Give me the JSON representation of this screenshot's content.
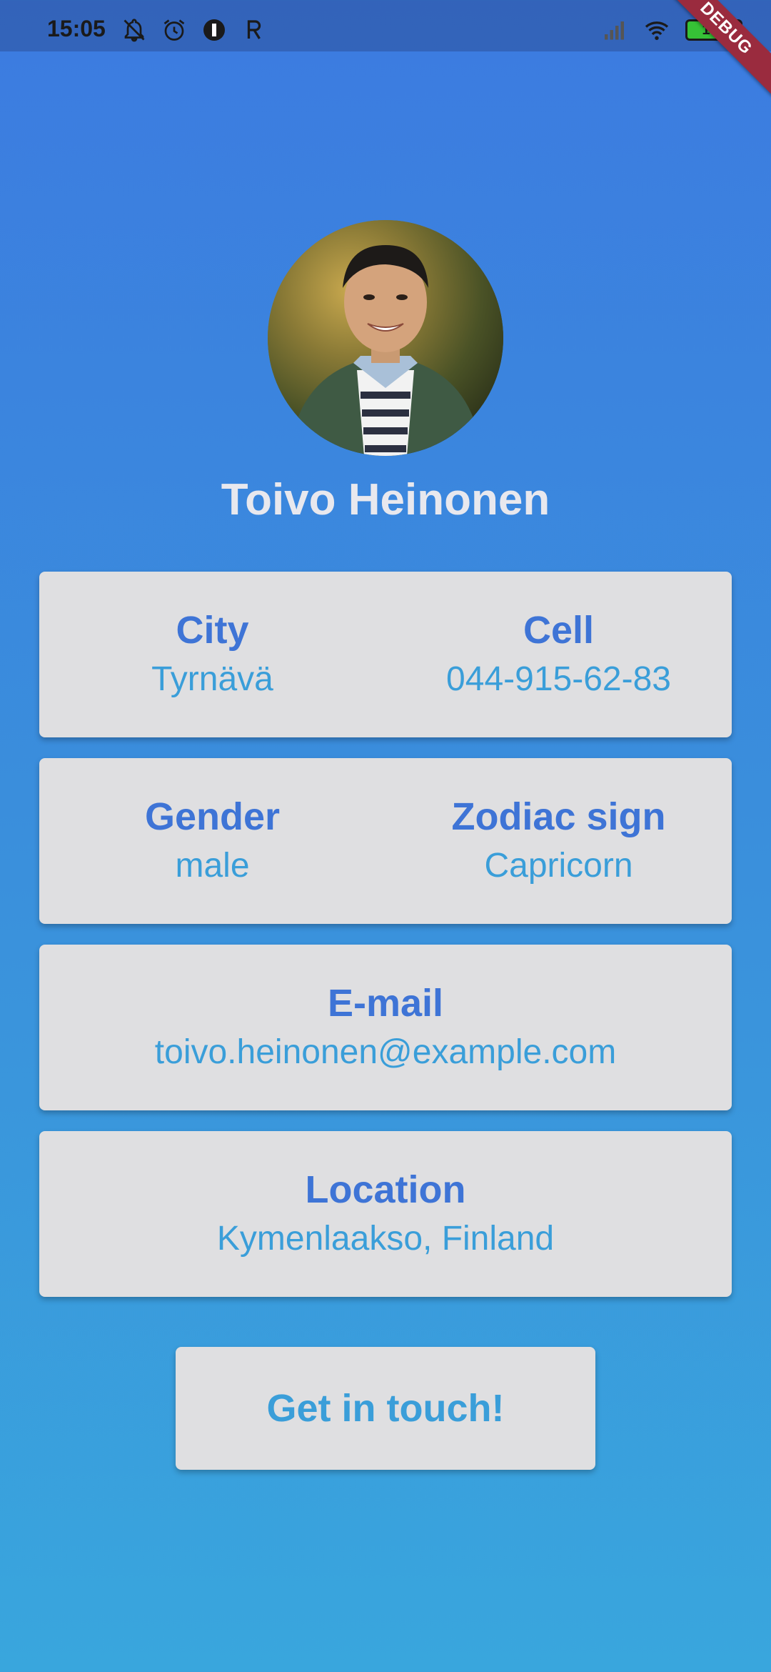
{
  "status_bar": {
    "time": "15:05",
    "battery": "100",
    "icons_left": [
      "bell-off-icon",
      "alarm-icon",
      "circle-app-icon",
      "r-app-icon"
    ],
    "icons_right": [
      "signal-icon",
      "wifi-icon",
      "battery-icon"
    ]
  },
  "debug_banner": "DEBUG",
  "profile": {
    "name": "Toivo Heinonen"
  },
  "cards": {
    "city": {
      "label": "City",
      "value": "Tyrnävä"
    },
    "cell": {
      "label": "Cell",
      "value": "044-915-62-83"
    },
    "gender": {
      "label": "Gender",
      "value": "male"
    },
    "zodiac": {
      "label": "Zodiac sign",
      "value": "Capricorn"
    },
    "email": {
      "label": "E-mail",
      "value": "toivo.heinonen@example.com"
    },
    "location": {
      "label": "Location",
      "value": "Kymenlaakso, Finland"
    }
  },
  "action_button": {
    "label": "Get in touch!"
  },
  "colors": {
    "background_top": "#3c7be0",
    "background_bottom": "#39a6dd",
    "card": "#dfdfe1",
    "label": "#3e74d6",
    "value": "#3a9ed9",
    "debug_ribbon": "#9a2b3e"
  }
}
